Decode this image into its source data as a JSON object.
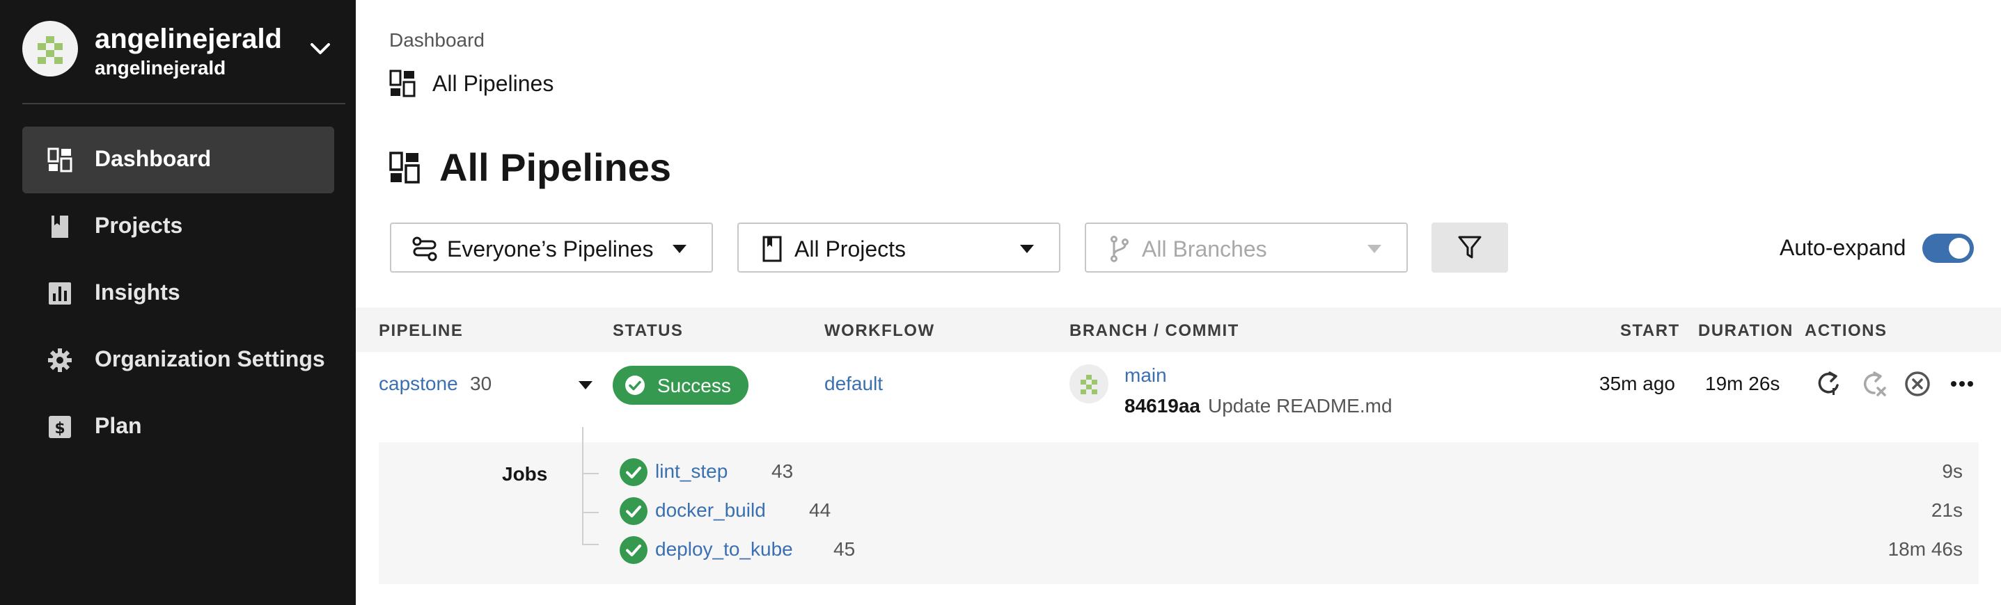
{
  "sidebar": {
    "org_name": "angelinejerald",
    "org_subname": "angelinejerald",
    "items": [
      {
        "label": "Dashboard",
        "icon": "dashboard-icon",
        "active": true
      },
      {
        "label": "Projects",
        "icon": "book-icon",
        "active": false
      },
      {
        "label": "Insights",
        "icon": "bar-chart-icon",
        "active": false
      },
      {
        "label": "Organization Settings",
        "icon": "gear-icon",
        "active": false
      },
      {
        "label": "Plan",
        "icon": "dollar-icon",
        "active": false
      }
    ]
  },
  "header": {
    "breadcrumb": "Dashboard",
    "subtitle": "All Pipelines",
    "title": "All Pipelines"
  },
  "filters": {
    "pipelines": "Everyone’s Pipelines",
    "projects": "All Projects",
    "branches": "All Branches",
    "auto_expand_label": "Auto-expand",
    "auto_expand_on": true
  },
  "table": {
    "headers": {
      "pipeline": "PIPELINE",
      "status": "STATUS",
      "workflow": "WORKFLOW",
      "branch_commit": "BRANCH / COMMIT",
      "start": "START",
      "duration": "DURATION",
      "actions": "ACTIONS"
    },
    "row": {
      "pipeline": "capstone",
      "number": "30",
      "status": "Success",
      "workflow": "default",
      "branch": "main",
      "commit_sha": "84619aa",
      "commit_message": "Update README.md",
      "start": "35m ago",
      "duration": "19m 26s"
    },
    "jobs_label": "Jobs",
    "jobs": [
      {
        "name": "lint_step",
        "number": "43",
        "duration": "9s"
      },
      {
        "name": "docker_build",
        "number": "44",
        "duration": "21s"
      },
      {
        "name": "deploy_to_kube",
        "number": "45",
        "duration": "18m 46s"
      }
    ]
  },
  "colors": {
    "sidebar_bg": "#161616",
    "link": "#3a70b2",
    "success": "#359a4f",
    "toggle": "#3b6fad"
  }
}
